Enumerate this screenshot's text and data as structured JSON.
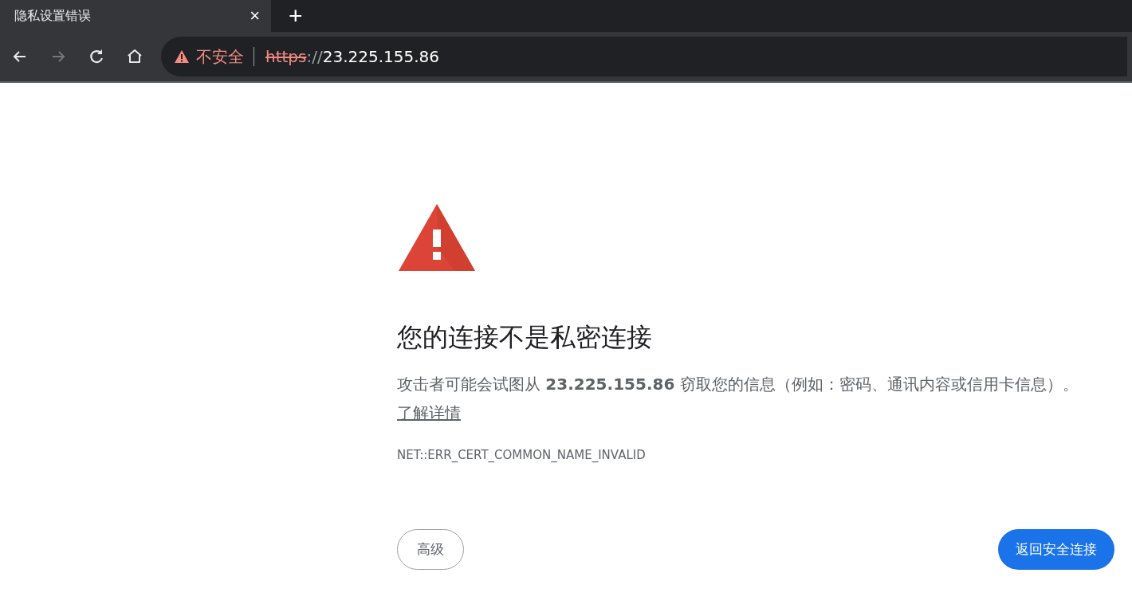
{
  "tabs": [
    {
      "title": "隐私设置错误",
      "selected": true,
      "close": "×"
    }
  ],
  "new_tab": "+",
  "nav_buttons": [
    {
      "kind": "back",
      "disabled": false
    },
    {
      "kind": "forward",
      "disabled": true
    },
    {
      "kind": "reload",
      "disabled": false
    },
    {
      "kind": "home",
      "disabled": false
    }
  ],
  "address_bar": {
    "secure": false,
    "security_label": "不安全",
    "scheme": "https",
    "separator": "://",
    "host": "23.225.155.86"
  },
  "page": {
    "heading": "您的连接不是私密连接",
    "body": "攻击者可能会试图从 **23.225.155.86** 窃取您的信息（例如：密码、通讯内容或信用卡信息）。",
    "link": "了解详情",
    "error_code": "NET::ERR_CERT_COMMON_NAME_INVALID",
    "buttons": [
      {
        "kind": "secondary",
        "label": "高级"
      },
      {
        "kind": "primary",
        "label": "返回安全连接"
      }
    ]
  }
}
